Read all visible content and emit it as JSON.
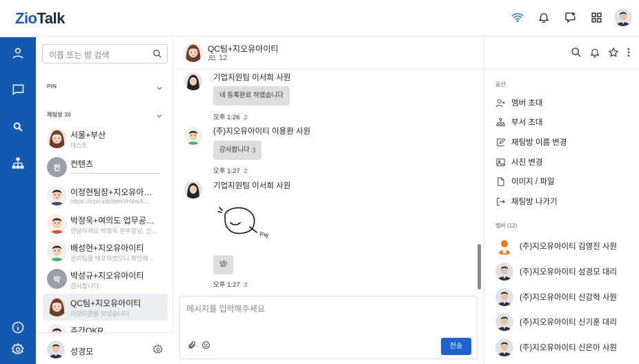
{
  "app": {
    "logo_a": "Zio",
    "logo_b": "Talk"
  },
  "sidebar": {
    "search_placeholder": "이름 또는 방 검색",
    "pin_label": "PIN",
    "rooms_label": "채팅방 30",
    "rooms": [
      {
        "name": "서울+부산",
        "preview": "테스트",
        "avatar": "face-woman"
      },
      {
        "name": "컨텐츠",
        "preview": "",
        "avatar": "letter",
        "letter": "컨"
      },
      {
        "name": "이정현팀장+지오유아…",
        "preview": "https://icon.kitchen/i/H4sIA…",
        "avatar": "face-man"
      },
      {
        "name": "박정욱+여의도 업무공…",
        "preview": "안녕하세요 박정욱 본부장님, 신…",
        "avatar": "face-man-red"
      },
      {
        "name": "배성현+지오유아이티",
        "preview": "관리팀용 배포하였으니 확인해…",
        "avatar": "face-man-green"
      },
      {
        "name": "박성규+지오유아이티",
        "preview": "감사합니다.",
        "avatar": "letter",
        "letter": "박"
      },
      {
        "name": "QC팀+지오유아이티",
        "preview": "이모티콘을 보냈습니다",
        "avatar": "face-woman"
      },
      {
        "name": "주간OKR",
        "preview": "",
        "avatar": "face-man"
      }
    ],
    "me_name": "성경모"
  },
  "chat": {
    "title": "QC팀+지오유아이티",
    "member_count": "12",
    "messages": [
      {
        "sender": "기업지원팀 이서희 사원",
        "text": "네 등록완료 하였습니다",
        "time": "오후 1:26",
        "unread": "2"
      },
      {
        "sender": "(주)지오유아이티 이용환 사원",
        "text": "감사합니다 :)",
        "time": "오후 1:27",
        "unread": "2"
      },
      {
        "sender": "기업지원팀 이서희 사원",
        "text": "넵!",
        "time": "오후 1:27",
        "unread": "2"
      }
    ],
    "sticker_text": "꾸벅",
    "input_placeholder": "메시지를 입력해주세요",
    "send_label": "전송"
  },
  "options": {
    "section_label": "옵션",
    "items": [
      {
        "label": "멤버 초대",
        "icon": "person-add-icon"
      },
      {
        "label": "부서 초대",
        "icon": "org-icon"
      },
      {
        "label": "채팅방 이름 변경",
        "icon": "edit-icon"
      },
      {
        "label": "사진 변경",
        "icon": "image-icon"
      },
      {
        "label": "이미지 / 파일",
        "icon": "file-icon"
      },
      {
        "label": "채팅방 나가기",
        "icon": "exit-icon"
      }
    ],
    "members_label": "멤버 (12)",
    "members": [
      {
        "name": "(주)지오유아이티 김영진 사원"
      },
      {
        "name": "(주)지오유아이티 성경모 대리"
      },
      {
        "name": "(주)지오유아이티 신강혁 사원"
      },
      {
        "name": "(주)지오유아이티 신기훈 대리"
      },
      {
        "name": "(주)지오유아이티 신은아 사원"
      }
    ]
  },
  "colors": {
    "accent": "#1558b0",
    "send": "#1e62d0",
    "unread": "#e0282e"
  }
}
